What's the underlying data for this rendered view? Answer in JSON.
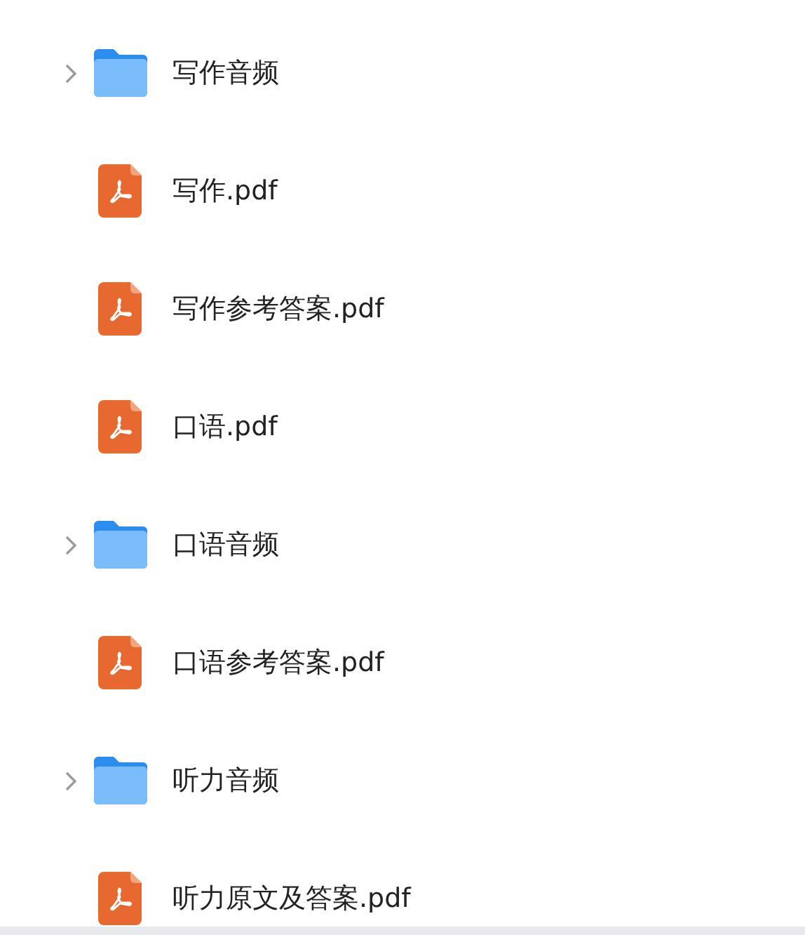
{
  "items": [
    {
      "kind": "folder",
      "name": "写作音频",
      "expanded": false
    },
    {
      "kind": "pdf",
      "name": "写作.pdf"
    },
    {
      "kind": "pdf",
      "name": "写作参考答案.pdf"
    },
    {
      "kind": "pdf",
      "name": "口语.pdf"
    },
    {
      "kind": "folder",
      "name": "口语音频",
      "expanded": false
    },
    {
      "kind": "pdf",
      "name": "口语参考答案.pdf"
    },
    {
      "kind": "folder",
      "name": "听力音频",
      "expanded": false
    },
    {
      "kind": "pdf",
      "name": "听力原文及答案.pdf"
    }
  ]
}
